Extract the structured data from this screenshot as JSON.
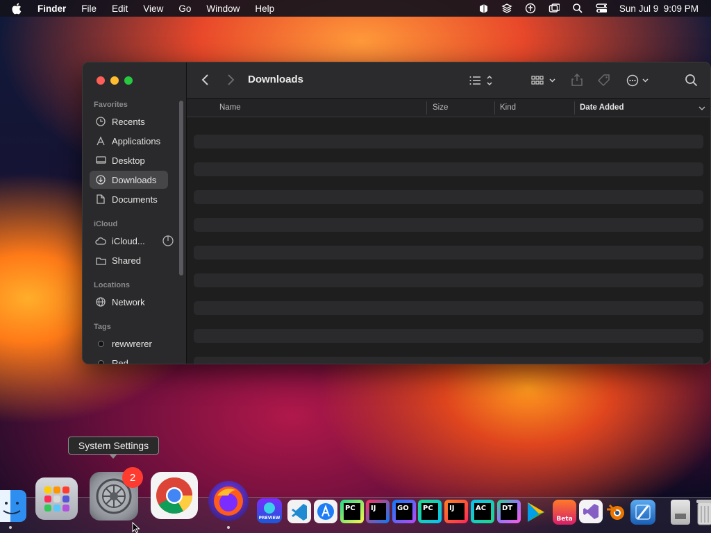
{
  "menubar": {
    "app_name": "Finder",
    "menus": [
      "File",
      "Edit",
      "View",
      "Go",
      "Window",
      "Help"
    ],
    "clock": "Sun Jul 9  9:09 PM"
  },
  "window": {
    "title": "Downloads",
    "sidebar": {
      "favorites_label": "Favorites",
      "favorites": [
        "Recents",
        "Applications",
        "Desktop",
        "Downloads",
        "Documents"
      ],
      "icloud_label": "iCloud",
      "icloud": [
        "iCloud...",
        "Shared"
      ],
      "locations_label": "Locations",
      "locations": [
        "Network"
      ],
      "tags_label": "Tags",
      "tags": [
        "rewwrerer",
        "Red"
      ]
    },
    "columns": {
      "name": "Name",
      "size": "Size",
      "kind": "Kind",
      "date_added": "Date Added"
    }
  },
  "tooltip": {
    "text": "System Settings"
  },
  "dock": {
    "settings_badge": "2",
    "labels": {
      "pycharm": "PC",
      "intellij": "IJ",
      "goland": "GO",
      "pycharm2": "PC",
      "intellij2": "IJ",
      "appcode": "AC",
      "datagrip": "DT",
      "beta": "Beta",
      "preview": "PREVIEW"
    }
  },
  "colors": {
    "accent_red": "#ff5f57",
    "accent_yellow": "#febc2e",
    "accent_green": "#28c840",
    "badge": "#ff3b30"
  }
}
